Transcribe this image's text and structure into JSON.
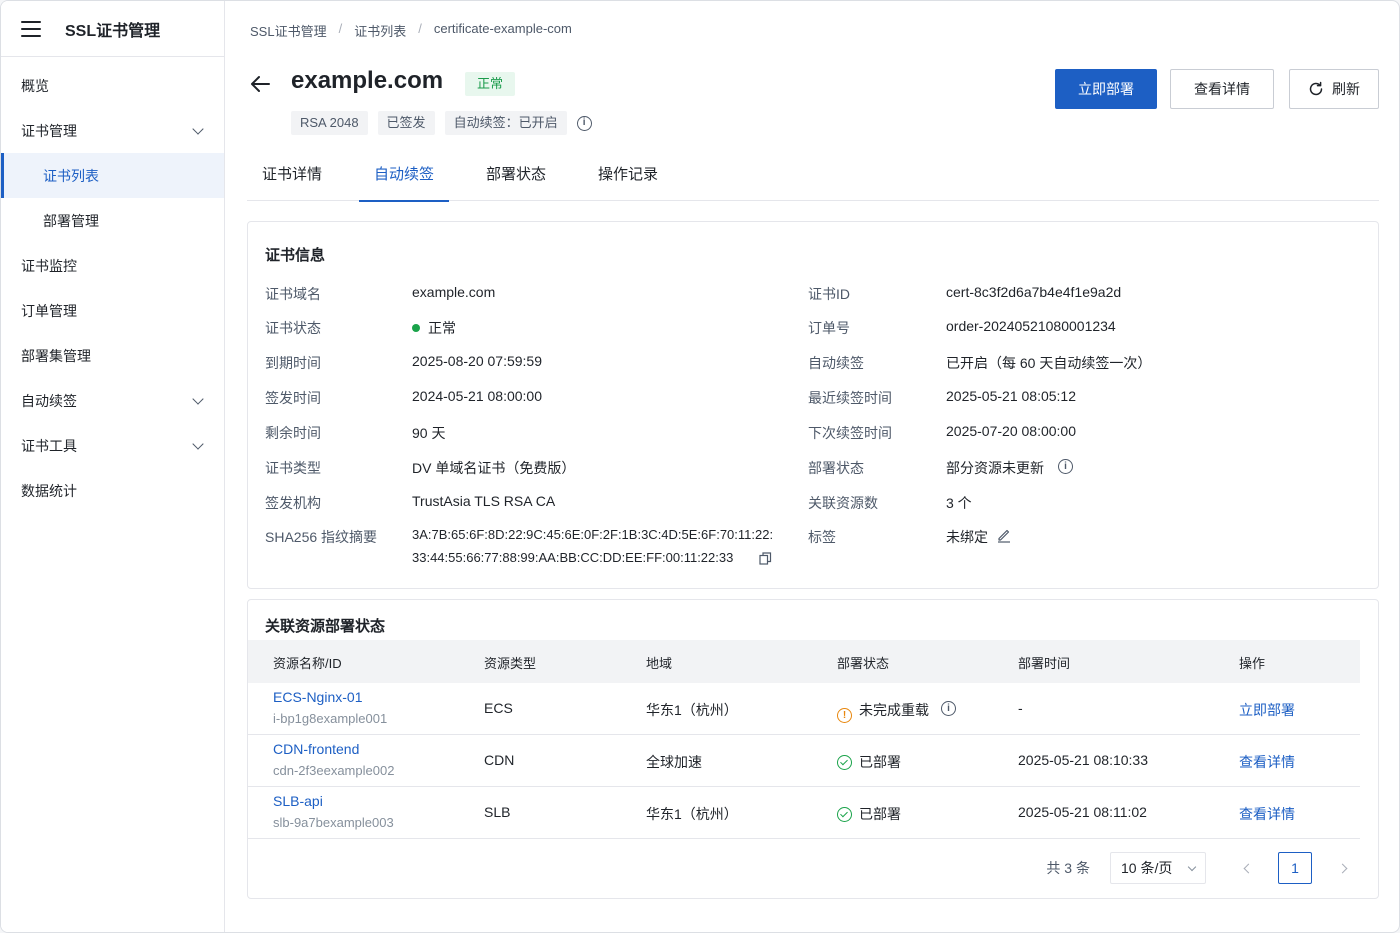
{
  "sidebar": {
    "title": "SSL证书管理",
    "items": [
      {
        "label": "概览"
      },
      {
        "label": "证书管理"
      },
      {
        "label": "证书列表"
      },
      {
        "label": "部署管理"
      },
      {
        "label": "证书监控"
      },
      {
        "label": "订单管理"
      },
      {
        "label": "部署集管理"
      },
      {
        "label": "自动续签"
      },
      {
        "label": "证书工具"
      },
      {
        "label": "数据统计"
      }
    ]
  },
  "breadcrumb": [
    "SSL证书管理",
    "证书列表",
    "certificate-example-com"
  ],
  "header": {
    "title": "example.com",
    "status": "正常",
    "tags": [
      "RSA 2048",
      "已签发",
      "自动续签：已开启"
    ],
    "buttons": {
      "deploy": "立即部署",
      "details": "查看详情",
      "refresh": "刷新"
    }
  },
  "tabs": [
    "证书详情",
    "自动续签",
    "部署状态",
    "操作记录"
  ],
  "info": {
    "title": "证书信息",
    "left": [
      {
        "k": "证书域名",
        "v": "example.com"
      },
      {
        "k": "证书状态",
        "v": "正常"
      },
      {
        "k": "到期时间",
        "v": "2025-08-20 07:59:59"
      },
      {
        "k": "签发时间",
        "v": "2024-05-21 08:00:00"
      },
      {
        "k": "剩余时间",
        "v": "90 天"
      },
      {
        "k": "证书类型",
        "v": "DV 单域名证书（免费版）"
      },
      {
        "k": "签发机构",
        "v": "TrustAsia TLS RSA CA"
      },
      {
        "k": "SHA256 指纹摘要",
        "v": "3A:7B:65:6F:8D:22:9C:45:6E:0F:2F:1B:3C:4D:5E:6F:70:11:22:",
        "v2": "33:44:55:66:77:88:99:AA:BB:CC:DD:EE:FF:00:11:22:33"
      }
    ],
    "right": [
      {
        "k": "证书ID",
        "v": "cert-8c3f2d6a7b4e4f1e9a2d"
      },
      {
        "k": "订单号",
        "v": "order-20240521080001234"
      },
      {
        "k": "自动续签",
        "v": "已开启（每 60 天自动续签一次）"
      },
      {
        "k": "最近续签时间",
        "v": "2025-05-21 08:05:12"
      },
      {
        "k": "下次续签时间",
        "v": "2025-07-20 08:00:00"
      },
      {
        "k": "部署状态",
        "v": "部分资源未更新"
      },
      {
        "k": "关联资源数",
        "v": "3 个"
      },
      {
        "k": "标签",
        "v": "未绑定"
      }
    ]
  },
  "resources": {
    "title": "关联资源部署状态",
    "columns": [
      "资源名称/ID",
      "资源类型",
      "地域",
      "部署状态",
      "部署时间",
      "操作"
    ],
    "rows": [
      {
        "name": "ECS-Nginx-01",
        "id": "i-bp1g8example001",
        "type": "ECS",
        "region": "华东1（杭州）",
        "status": "未完成重载",
        "time": "-",
        "action": "立即部署"
      },
      {
        "name": "CDN-frontend",
        "id": "cdn-2f3eexample002",
        "type": "CDN",
        "region": "全球加速",
        "status": "已部署",
        "time": "2025-05-21 08:10:33",
        "action": "查看详情"
      },
      {
        "name": "SLB-api",
        "id": "slb-9a7bexample003",
        "type": "SLB",
        "region": "华东1（杭州）",
        "status": "已部署",
        "time": "2025-05-21 08:11:02",
        "action": "查看详情"
      }
    ],
    "pager": {
      "total": "共 3 条",
      "page_size": "10 条/页",
      "current": "1"
    }
  },
  "colors": {
    "primary": "#1d5fc4",
    "success": "#1aa34a",
    "warning": "#e8870e"
  }
}
